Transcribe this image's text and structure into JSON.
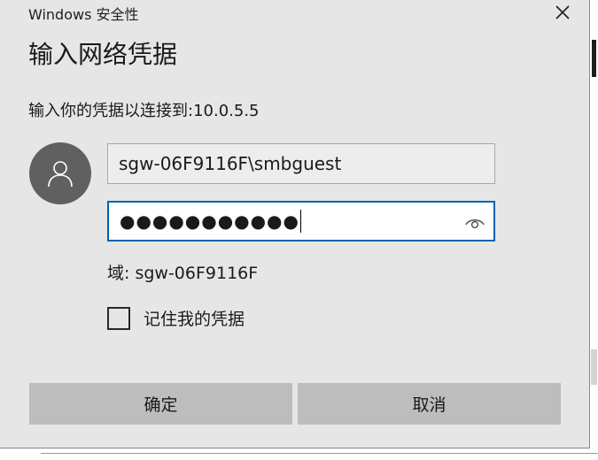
{
  "window": {
    "title": "Windows 安全性"
  },
  "dialog": {
    "heading": "输入网络凭据",
    "subtitle": "输入你的凭据以连接到:10.0.5.5"
  },
  "form": {
    "username_value": "sgw-06F9116F\\smbguest",
    "password_masked": "●●●●●●●●●●●",
    "domain_text": "域: sgw-06F9116F",
    "remember_label": "记住我的凭据",
    "remember_checked": false
  },
  "buttons": {
    "ok_label": "确定",
    "cancel_label": "取消"
  },
  "icons": {
    "close": "close-icon",
    "avatar": "user-icon",
    "reveal": "eye-icon"
  },
  "colors": {
    "dialog_bg": "#e6e6e6",
    "focus_border": "#0063b1",
    "button_bg": "#bdbdbd",
    "avatar_bg": "#606060"
  }
}
